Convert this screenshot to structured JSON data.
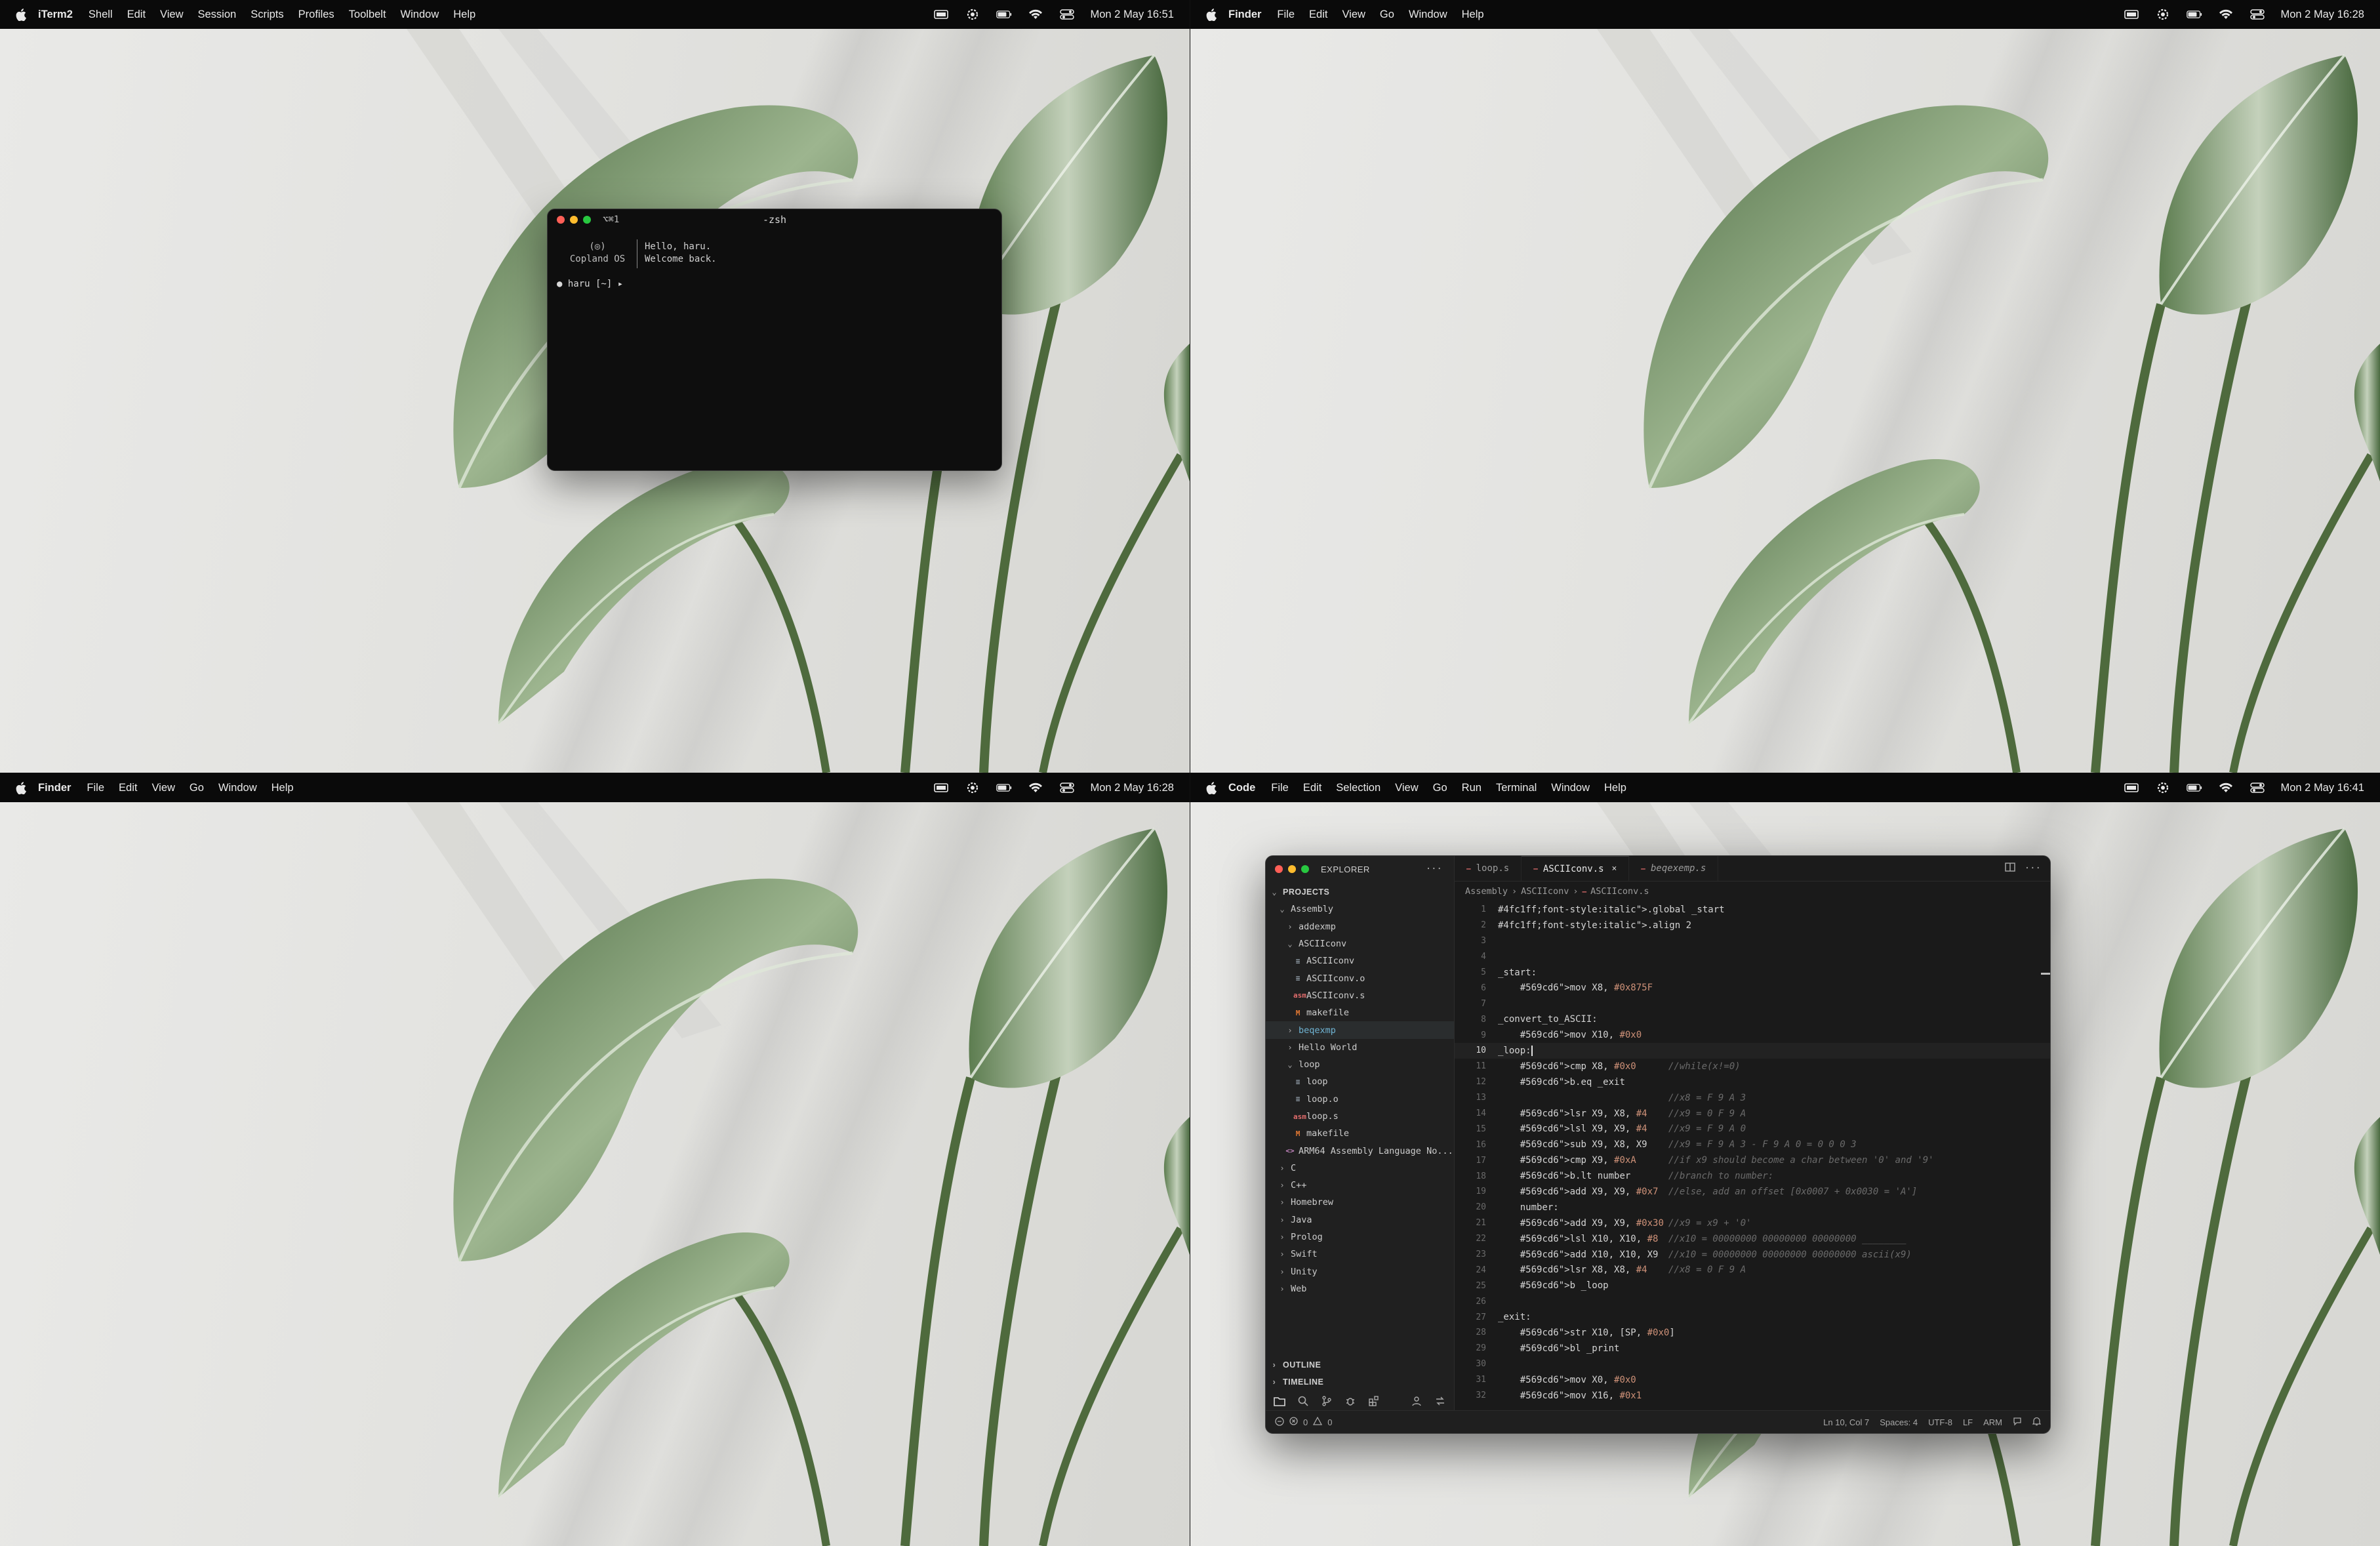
{
  "quadrants": [
    {
      "menubar": {
        "app": "iTerm2",
        "items": [
          "Shell",
          "Edit",
          "View",
          "Session",
          "Scripts",
          "Profiles",
          "Toolbelt",
          "Window",
          "Help"
        ],
        "clock": "Mon 2 May  16:51"
      }
    },
    {
      "menubar": {
        "app": "Finder",
        "items": [
          "File",
          "Edit",
          "View",
          "Go",
          "Window",
          "Help"
        ],
        "clock": "Mon 2 May  16:28"
      }
    },
    {
      "menubar": {
        "app": "Finder",
        "items": [
          "File",
          "Edit",
          "View",
          "Go",
          "Window",
          "Help"
        ],
        "clock": "Mon 2 May  16:28"
      }
    },
    {
      "menubar": {
        "app": "Code",
        "items": [
          "File",
          "Edit",
          "Selection",
          "View",
          "Go",
          "Run",
          "Terminal",
          "Window",
          "Help"
        ],
        "clock": "Mon 2 May  16:41"
      }
    }
  ],
  "terminal": {
    "shortcut": "⌥⌘1",
    "title": "-zsh",
    "logo_line1": "(◎)",
    "logo_line2": "Copland OS",
    "greeting_line1": "Hello, haru.",
    "greeting_line2": "Welcome back.",
    "prompt": "● haru [~] ▸"
  },
  "vscode": {
    "explorer_label": "EXPLORER",
    "more": "···",
    "tree": [
      {
        "label": "PROJECTS",
        "chev": "⌄",
        "indent": 0,
        "kind": "section"
      },
      {
        "label": "Assembly",
        "chev": "⌄",
        "indent": 1,
        "kind": "folder"
      },
      {
        "label": "addexmp",
        "chev": "›",
        "indent": 2,
        "kind": "folder"
      },
      {
        "label": "ASCIIconv",
        "chev": "⌄",
        "indent": 2,
        "kind": "folder"
      },
      {
        "label": "ASCIIconv",
        "icon": "≡",
        "indent": 3,
        "kind": "file"
      },
      {
        "label": "ASCIIconv.o",
        "icon": "≡",
        "indent": 3,
        "kind": "file"
      },
      {
        "label": "ASCIIconv.s",
        "icon": "asm",
        "indent": 3,
        "kind": "asm"
      },
      {
        "label": "makefile",
        "icon": "M",
        "indent": 3,
        "kind": "make"
      },
      {
        "label": "beqexmp",
        "chev": "›",
        "indent": 2,
        "kind": "folder",
        "selected": true
      },
      {
        "label": "Hello World",
        "chev": "›",
        "indent": 2,
        "kind": "folder"
      },
      {
        "label": "loop",
        "chev": "⌄",
        "indent": 2,
        "kind": "folder"
      },
      {
        "label": "loop",
        "icon": "≡",
        "indent": 3,
        "kind": "file"
      },
      {
        "label": "loop.o",
        "icon": "≡",
        "indent": 3,
        "kind": "file"
      },
      {
        "label": "loop.s",
        "icon": "asm",
        "indent": 3,
        "kind": "asm"
      },
      {
        "label": "makefile",
        "icon": "M",
        "indent": 3,
        "kind": "make"
      },
      {
        "label": "ARM64 Assembly Language No...",
        "icon": "<>",
        "indent": 2,
        "kind": "ext"
      },
      {
        "label": "C",
        "chev": "›",
        "indent": 1,
        "kind": "folder"
      },
      {
        "label": "C++",
        "chev": "›",
        "indent": 1,
        "kind": "folder"
      },
      {
        "label": "Homebrew",
        "chev": "›",
        "indent": 1,
        "kind": "folder"
      },
      {
        "label": "Java",
        "chev": "›",
        "indent": 1,
        "kind": "folder"
      },
      {
        "label": "Prolog",
        "chev": "›",
        "indent": 1,
        "kind": "folder"
      },
      {
        "label": "Swift",
        "chev": "›",
        "indent": 1,
        "kind": "folder"
      },
      {
        "label": "Unity",
        "chev": "›",
        "indent": 1,
        "kind": "folder"
      },
      {
        "label": "Web",
        "chev": "›",
        "indent": 1,
        "kind": "folder"
      }
    ],
    "outline": "OUTLINE",
    "timeline": "TIMELINE",
    "tabs": [
      {
        "label": "loop.s",
        "active": false,
        "italic": false
      },
      {
        "label": "ASCIIconv.s",
        "active": true,
        "italic": false,
        "close": "×"
      },
      {
        "label": "beqexemp.s",
        "active": false,
        "italic": true
      }
    ],
    "breadcrumb": [
      "Assembly",
      "ASCIIconv",
      "ASCIIconv.s"
    ],
    "code": [
      {
        "n": "1",
        "code": ".global _start",
        "c": ""
      },
      {
        "n": "2",
        "code": ".align 2",
        "c": ""
      },
      {
        "n": "3",
        "code": "",
        "c": ""
      },
      {
        "n": "4",
        "code": "",
        "c": ""
      },
      {
        "n": "5",
        "code": "_start:",
        "c": ""
      },
      {
        "n": "6",
        "code": "    mov X8, #0x875F",
        "c": ""
      },
      {
        "n": "7",
        "code": "",
        "c": ""
      },
      {
        "n": "8",
        "code": "_convert_to_ASCII:",
        "c": ""
      },
      {
        "n": "9",
        "code": "    mov X10, #0x0",
        "c": ""
      },
      {
        "n": "10",
        "code": "_loop:",
        "c": "",
        "current": true
      },
      {
        "n": "11",
        "code": "    cmp X8, #0x0",
        "c": "//while(x!=0)"
      },
      {
        "n": "12",
        "code": "    b.eq _exit",
        "c": ""
      },
      {
        "n": "13",
        "code": "",
        "c": "//x8 = F 9 A 3"
      },
      {
        "n": "14",
        "code": "    lsr X9, X8, #4",
        "c": "//x9 = 0 F 9 A"
      },
      {
        "n": "15",
        "code": "    lsl X9, X9, #4",
        "c": "//x9 = F 9 A 0"
      },
      {
        "n": "16",
        "code": "    sub X9, X8, X9",
        "c": "//x9 = F 9 A 3 - F 9 A 0 = 0 0 0 3"
      },
      {
        "n": "17",
        "code": "    cmp X9, #0xA",
        "c": "//if x9 should become a char between '0' and '9'"
      },
      {
        "n": "18",
        "code": "    b.lt number",
        "c": "//branch to number:"
      },
      {
        "n": "19",
        "code": "    add X9, X9, #0x7",
        "c": "//else, add an offset [0x0007 + 0x0030 = 'A']"
      },
      {
        "n": "20",
        "code": "    number:",
        "c": ""
      },
      {
        "n": "21",
        "code": "    add X9, X9, #0x30",
        "c": "//x9 = x9 + '0'"
      },
      {
        "n": "22",
        "code": "    lsl X10, X10, #8",
        "c": "//x10 = 00000000 00000000 00000000 ________"
      },
      {
        "n": "23",
        "code": "    add X10, X10, X9",
        "c": "//x10 = 00000000 00000000 00000000 ascii(x9)"
      },
      {
        "n": "24",
        "code": "    lsr X8, X8, #4",
        "c": "//x8 = 0 F 9 A"
      },
      {
        "n": "25",
        "code": "    b _loop",
        "c": ""
      },
      {
        "n": "26",
        "code": "",
        "c": ""
      },
      {
        "n": "27",
        "code": "_exit:",
        "c": ""
      },
      {
        "n": "28",
        "code": "    str X10, [SP, #0x0]",
        "c": ""
      },
      {
        "n": "29",
        "code": "    bl _print",
        "c": ""
      },
      {
        "n": "30",
        "code": "",
        "c": ""
      },
      {
        "n": "31",
        "code": "    mov X0, #0x0",
        "c": ""
      },
      {
        "n": "32",
        "code": "    mov X16, #0x1",
        "c": ""
      }
    ],
    "status": {
      "errors": "0",
      "warnings": "0",
      "position": "Ln 10, Col 7",
      "spaces": "Spaces: 4",
      "encoding": "UTF-8",
      "eol": "LF",
      "language": "ARM"
    }
  },
  "colors": {
    "keyword": "#569cd6",
    "directive": "#4fc1ff",
    "number": "#ce9178",
    "comment": "#6a6a6a",
    "label": "#d4d4d4"
  }
}
